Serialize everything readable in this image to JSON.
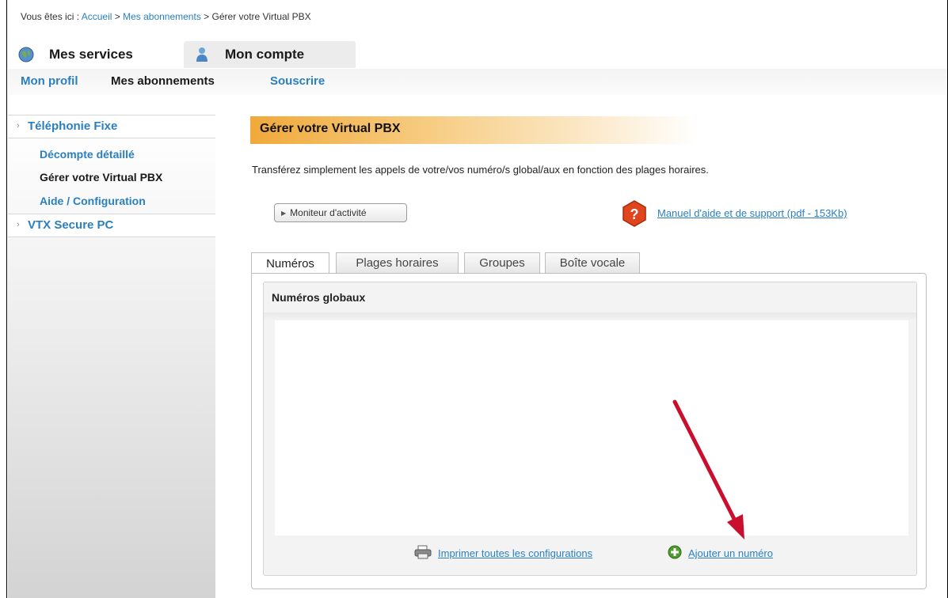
{
  "breadcrumb": {
    "prefix": "Vous êtes ici : ",
    "home": "Accueil",
    "sep1": " > ",
    "subscriptions": "Mes abonnements",
    "sep2": " > ",
    "current": "Gérer votre Virtual PBX"
  },
  "top_tabs": [
    {
      "label": "Mes services",
      "icon": "globe-icon"
    },
    {
      "label": "Mon compte",
      "icon": "user-icon",
      "active": true
    }
  ],
  "subnav": {
    "profile": "Mon profil",
    "subscriptions": "Mes abonnements",
    "subscribe": "Souscrire"
  },
  "sidebar": {
    "section1": "Téléphonie Fixe",
    "items": [
      "Décompte détaillé",
      "Gérer votre Virtual PBX",
      "Aide / Configuration"
    ],
    "section2": "VTX Secure PC"
  },
  "main": {
    "title": "Gérer votre Virtual PBX",
    "description": "Transférez simplement les appels de votre/vos numéro/s global/aux en fonction des plages horaires.",
    "monitor_button": "Moniteur d'activité",
    "help_link": "Manuel d'aide et de support (pdf - 153Kb)",
    "tabs": [
      "Numéros",
      "Plages horaires",
      "Groupes",
      "Boîte vocale"
    ],
    "panel_title": "Numéros globaux",
    "print_link": "Imprimer toutes les configurations",
    "add_link": "Ajouter un numéro"
  },
  "colors": {
    "link": "#2a7fc0",
    "title_gradient_start": "#f0a93a",
    "arrow": "#c8102e"
  }
}
